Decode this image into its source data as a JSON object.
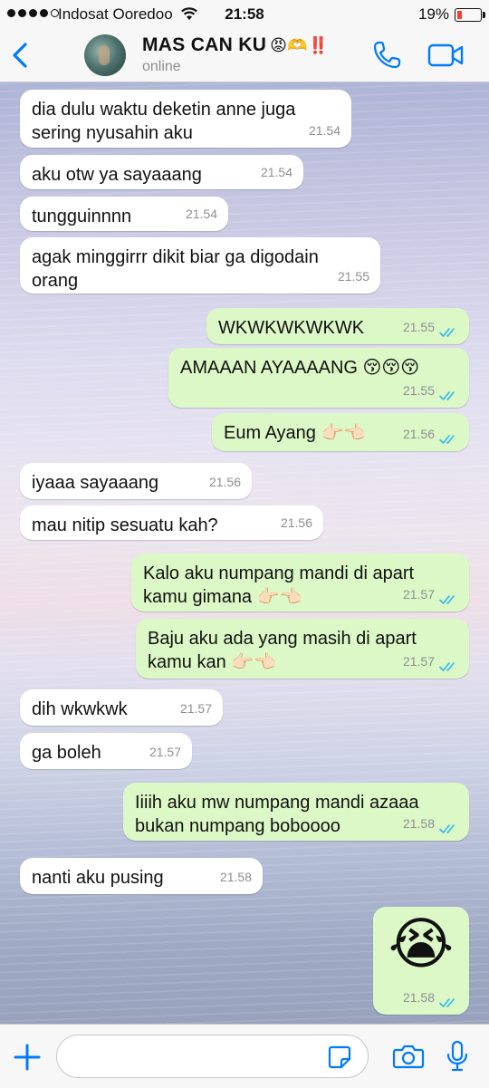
{
  "status_bar": {
    "carrier": "Indosat Ooredoo",
    "time": "21:58",
    "battery_percent": "19%",
    "signal_bars": 4
  },
  "header": {
    "contact_name": "MAS CAN KU",
    "contact_emoji": "😡🫶‼️",
    "status": "online"
  },
  "messages": [
    {
      "dir": "in",
      "lines": [
        "dia dulu waktu deketin anne juga",
        "sering nyusahin aku"
      ],
      "time": "21.54"
    },
    {
      "dir": "in",
      "lines": [
        "aku otw ya sayaaang"
      ],
      "time": "21.54"
    },
    {
      "dir": "in",
      "lines": [
        "tungguinnnn"
      ],
      "time": "21.54"
    },
    {
      "dir": "in",
      "lines": [
        "agak minggirrr dikit biar ga digodain",
        "orang"
      ],
      "time": "21.55"
    },
    {
      "dir": "out",
      "lines": [
        "WKWKWKWKWK"
      ],
      "time": "21.55",
      "read": true
    },
    {
      "dir": "out",
      "lines": [
        "AMAAAN AYAAAANG 😚😚😚"
      ],
      "time": "21.55",
      "read": true
    },
    {
      "dir": "out",
      "lines": [
        "Eum Ayang 👉🏻👈🏻"
      ],
      "time": "21.56",
      "read": true
    },
    {
      "dir": "in",
      "lines": [
        "iyaaa sayaaang"
      ],
      "time": "21.56"
    },
    {
      "dir": "in",
      "lines": [
        "mau nitip sesuatu kah?"
      ],
      "time": "21.56"
    },
    {
      "dir": "out",
      "lines": [
        "Kalo aku numpang mandi di apart",
        "kamu gimana 👉🏻👈🏻"
      ],
      "time": "21.57",
      "read": true
    },
    {
      "dir": "out",
      "lines": [
        "Baju aku ada yang masih di apart",
        "kamu kan 👉🏻👈🏻"
      ],
      "time": "21.57",
      "read": true
    },
    {
      "dir": "in",
      "lines": [
        "dih wkwkwk"
      ],
      "time": "21.57"
    },
    {
      "dir": "in",
      "lines": [
        "ga boleh"
      ],
      "time": "21.57"
    },
    {
      "dir": "out",
      "lines": [
        "Iiiih aku mw numpang mandi azaaa",
        "bukan numpang boboooo"
      ],
      "time": "21.58",
      "read": true
    },
    {
      "dir": "in",
      "lines": [
        "nanti aku pusing"
      ],
      "time": "21.58"
    },
    {
      "dir": "out",
      "lines": [
        "😭"
      ],
      "time": "21.58",
      "read": true,
      "big_emoji": true
    }
  ],
  "input": {
    "value": "",
    "placeholder": ""
  },
  "icons": {
    "back": "chevron-left-icon",
    "call": "phone-icon",
    "video": "video-camera-icon",
    "attach": "plus-icon",
    "sticker": "sticker-icon",
    "camera": "camera-icon",
    "mic": "microphone-icon"
  },
  "colors": {
    "accent": "#007aff",
    "outgoing_bubble": "#dcf8c6",
    "incoming_bubble": "#ffffff",
    "read_ticks": "#34b7f1",
    "battery_low": "#ff3b30"
  }
}
